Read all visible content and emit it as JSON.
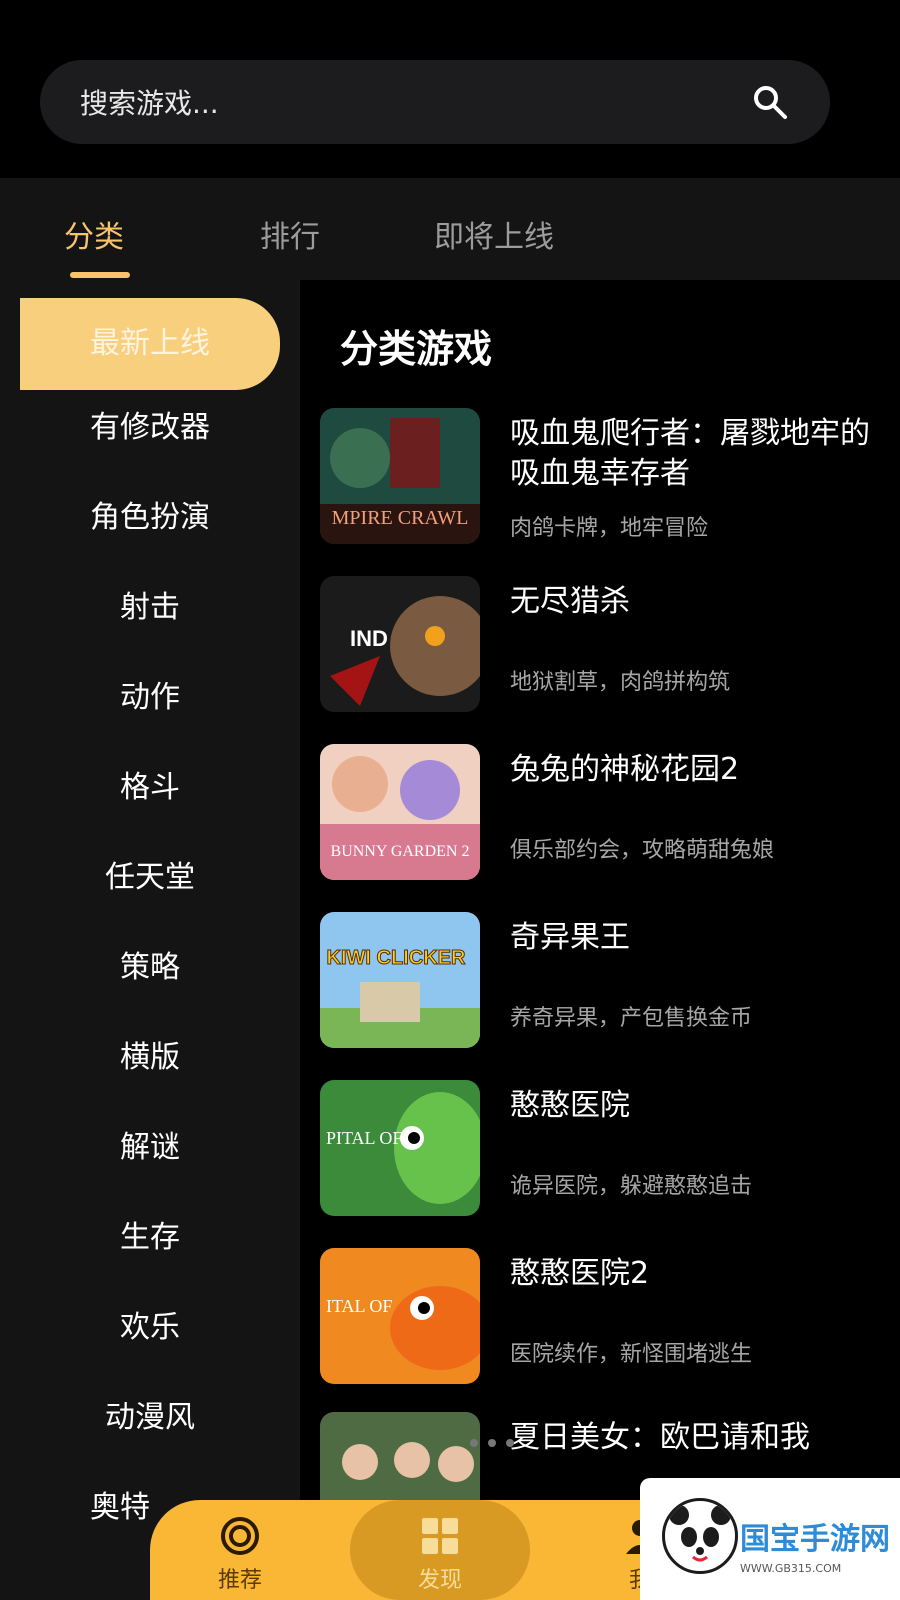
{
  "search": {
    "placeholder": "搜索游戏..."
  },
  "tabs": [
    {
      "label": "分类"
    },
    {
      "label": "排行"
    },
    {
      "label": "即将上线"
    }
  ],
  "sidebar": {
    "items": [
      {
        "label": "最新上线"
      },
      {
        "label": "有修改器"
      },
      {
        "label": "角色扮演"
      },
      {
        "label": "射击"
      },
      {
        "label": "动作"
      },
      {
        "label": "格斗"
      },
      {
        "label": "任天堂"
      },
      {
        "label": "策略"
      },
      {
        "label": "横版"
      },
      {
        "label": "解谜"
      },
      {
        "label": "生存"
      },
      {
        "label": "欢乐"
      },
      {
        "label": "动漫风"
      },
      {
        "label": "奥特"
      }
    ]
  },
  "main": {
    "title": "分类游戏",
    "games": [
      {
        "name": "吸血鬼爬行者：屠戮地牢的吸血鬼幸存者",
        "tags": "肉鸽卡牌，地牢冒险",
        "thumb_text": "MPIRE CRAWL"
      },
      {
        "name": "无尽猎杀",
        "tags": "地狱割草，肉鸽拼构筑",
        "thumb_text": "IND"
      },
      {
        "name": "兔兔的神秘花园2",
        "tags": "俱乐部约会，攻略萌甜兔娘",
        "thumb_text": "BUNNY GARDEN 2"
      },
      {
        "name": "奇异果王",
        "tags": "养奇异果，产包售换金币",
        "thumb_text": "KIWI CLICKER"
      },
      {
        "name": "憨憨医院",
        "tags": "诡异医院，躲避憨憨追击",
        "thumb_text": "PITAL OF"
      },
      {
        "name": "憨憨医院2",
        "tags": "医院续作，新怪围堵逃生",
        "thumb_text": "ITAL OF"
      },
      {
        "name": "夏日美女：欧巴请和我",
        "tags": "",
        "thumb_text": ""
      }
    ]
  },
  "bottom_nav": [
    {
      "label": "推荐",
      "icon": "target-icon"
    },
    {
      "label": "发现",
      "icon": "grid-icon"
    },
    {
      "label": "我",
      "icon": "user-icon"
    }
  ],
  "watermark": {
    "title": "国宝手游网",
    "url": "WWW.GB315.COM"
  },
  "colors": {
    "accent": "#f7c46a",
    "nav_bar": "#f9b735",
    "sidebar_active": "#f8cf7c"
  }
}
